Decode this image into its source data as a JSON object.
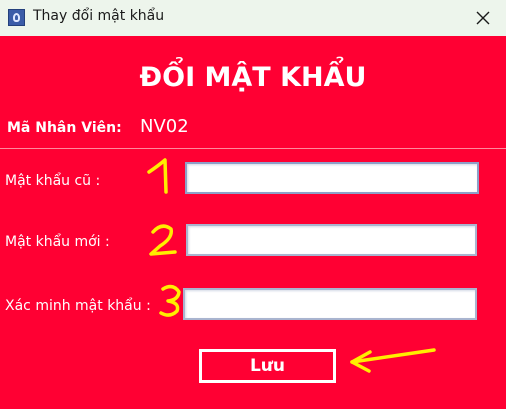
{
  "window": {
    "title": "Thay đổi mật khẩu",
    "icon": "java-app-icon",
    "close_icon": "close-icon"
  },
  "form": {
    "heading": "ĐỔI MẬT KHẨU",
    "employee_label": "Mã Nhân Viên:",
    "employee_value": "NV02",
    "fields": [
      {
        "label": "Mật khẩu cũ :",
        "value": ""
      },
      {
        "label": "Mật khẩu mới :",
        "value": ""
      },
      {
        "label": "Xác minh mật khẩu :",
        "value": ""
      }
    ],
    "save_label": "Lưu"
  },
  "annotations": {
    "markers": [
      "1",
      "2",
      "3"
    ],
    "marker_color": "#ffee00",
    "arrow_target": "save-button"
  },
  "colors": {
    "panel_bg": "#ff0033",
    "titlebar_bg": "#edf5ec",
    "text": "#ffffff"
  }
}
